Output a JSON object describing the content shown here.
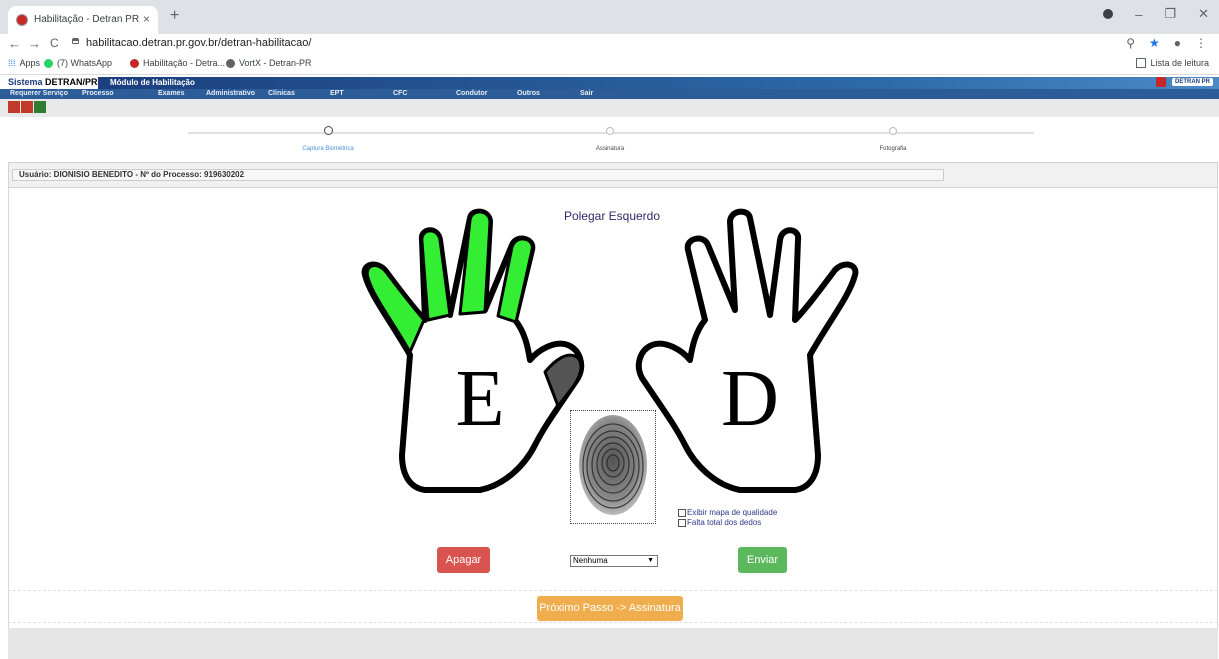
{
  "browser": {
    "tab_title": "Habilitação - Detran PR",
    "tab_close": "×",
    "new_tab": "+",
    "url": "habilitacao.detran.pr.gov.br/detran-habilitacao/",
    "back": "←",
    "forward": "→",
    "reload": "C",
    "window_min": "–",
    "window_restore": "❐",
    "window_close": "✕",
    "zoom_icon": "⚲",
    "star_icon": "★",
    "menu_icon": "⋮",
    "bookmarks": [
      {
        "label": "Apps",
        "color": "#4285f4"
      },
      {
        "label": "(7) WhatsApp",
        "color": "#25d366"
      },
      {
        "label": "Habilitação - Detra...",
        "color": "#c62828"
      },
      {
        "label": "VortX - Detran-PR",
        "color": "#5f6368"
      }
    ],
    "reading_list": "Lista de leitura"
  },
  "site": {
    "sistema_prefix": "Sistema ",
    "sistema_name": "DETRAN/PR",
    "modulo": "Módulo de Habilitação",
    "menu": [
      "Requerer Serviço",
      "Processo",
      "Exames",
      "Administrativo",
      "Clínicas",
      "EPT",
      "CFC",
      "Condutor",
      "Outros",
      "Sair"
    ],
    "logo_text": "DETRAN PR"
  },
  "steps": [
    {
      "label": "Captura Biométrica",
      "active": true
    },
    {
      "label": "Assinatura",
      "active": false
    },
    {
      "label": "Fotografia",
      "active": false
    }
  ],
  "user_line": "Usuário: DIONISIO BENEDITO - Nº do Processo: 919630202",
  "capture": {
    "finger_title": "Polegar Esquerdo",
    "left_hand_letter": "E",
    "right_hand_letter": "D",
    "checkbox_quality": "Exibir mapa de qualidade",
    "checkbox_missing": "Falta total dos dedos",
    "select_value": "Nenhuma",
    "btn_apagar": "Apagar",
    "btn_enviar": "Enviar",
    "btn_proximo": "Próximo Passo -> Assinatura",
    "colors": {
      "captured": "#33ee33",
      "current": "#555555",
      "apagar": "#d9534f",
      "enviar": "#5cb85c",
      "proximo": "#f0ad4e"
    }
  }
}
